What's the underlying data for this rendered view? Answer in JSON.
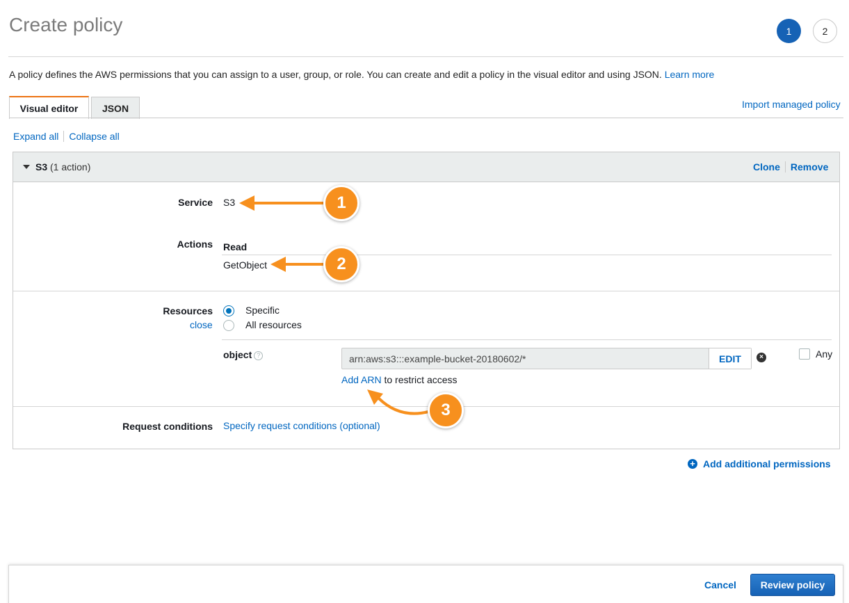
{
  "page": {
    "title": "Create policy",
    "steps": [
      "1",
      "2"
    ],
    "description": "A policy defines the AWS permissions that you can assign to a user, group, or role. You can create and edit a policy in the visual editor and using JSON.",
    "learn_more": "Learn more"
  },
  "tabs": {
    "visual": "Visual editor",
    "json": "JSON",
    "import": "Import managed policy"
  },
  "toggles": {
    "expand_all": "Expand all",
    "collapse_all": "Collapse all"
  },
  "panel": {
    "service_name": "S3",
    "action_count": "(1 action)",
    "clone": "Clone",
    "remove": "Remove",
    "service_label": "Service",
    "service_value": "S3",
    "actions_label": "Actions",
    "actions_group": "Read",
    "actions_item": "GetObject",
    "resources_label": "Resources",
    "resources_close": "close",
    "radio_specific": "Specific",
    "radio_all": "All resources",
    "object_label": "object",
    "arn_value": "arn:aws:s3:::example-bucket-20180602/*",
    "edit": "EDIT",
    "any": "Any",
    "add_arn": "Add ARN",
    "add_arn_suffix": "to restrict access",
    "conditions_label": "Request conditions",
    "conditions_link": "Specify request conditions (optional)"
  },
  "add_permissions": "Add additional permissions",
  "footer": {
    "cancel": "Cancel",
    "review": "Review policy"
  },
  "callouts": [
    "1",
    "2",
    "3"
  ],
  "colors": {
    "accent": "#f7901e",
    "primary": "#1662b5",
    "link": "#0066c0"
  }
}
